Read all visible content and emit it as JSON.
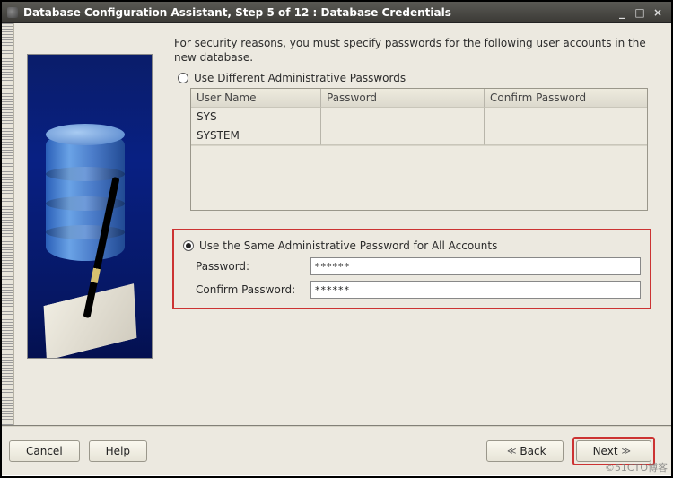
{
  "window": {
    "title": "Database Configuration Assistant, Step 5 of 12 : Database Credentials"
  },
  "intro": "For security reasons, you must specify passwords for the following user accounts in the new database.",
  "radios": {
    "different": "Use Different Administrative Passwords",
    "same": "Use the Same Administrative Password for All Accounts"
  },
  "table": {
    "headers": {
      "user": "User Name",
      "pwd": "Password",
      "confirm": "Confirm Password"
    },
    "rows": [
      {
        "user": "SYS",
        "pwd": "",
        "confirm": ""
      },
      {
        "user": "SYSTEM",
        "pwd": "",
        "confirm": ""
      }
    ]
  },
  "pwd_fields": {
    "label_pwd": "Password:",
    "label_confirm": "Confirm Password:",
    "value_pwd": "******",
    "value_confirm": "******"
  },
  "buttons": {
    "cancel": "Cancel",
    "help": "Help",
    "back": "Back",
    "next": "Next"
  },
  "watermark": "©51CTO博客"
}
